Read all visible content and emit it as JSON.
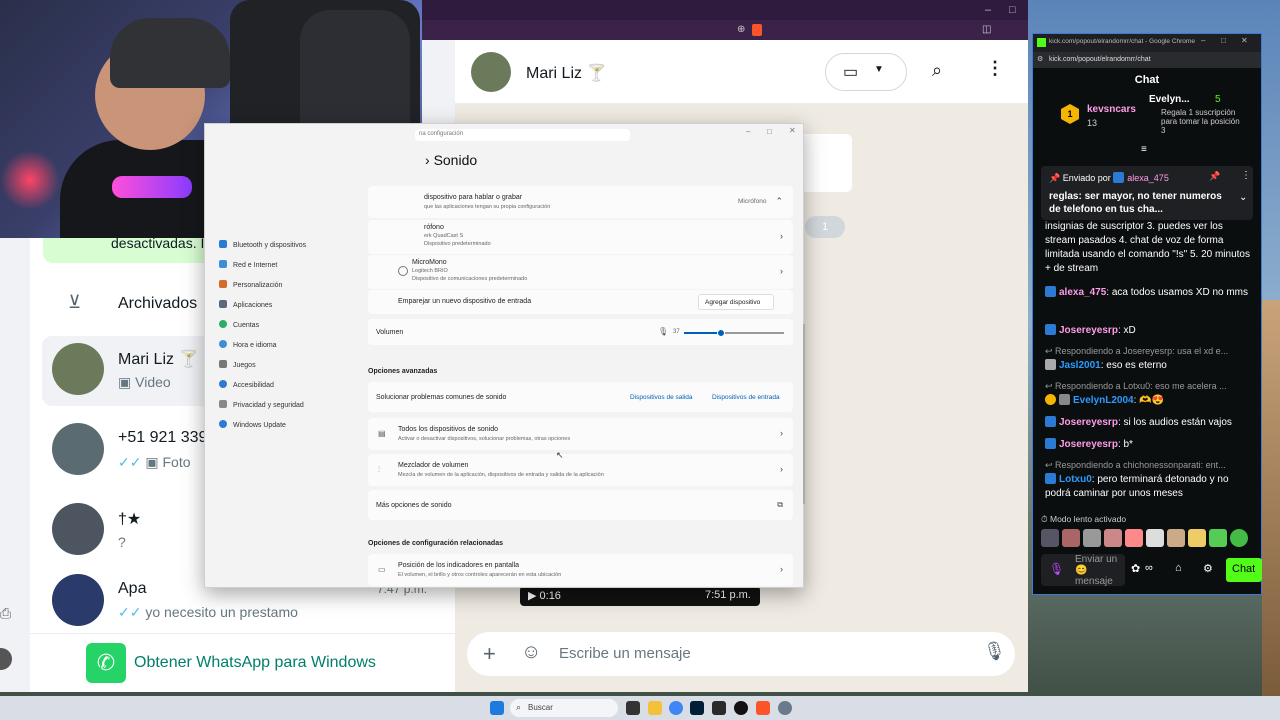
{
  "whatsapp": {
    "contact_header": {
      "name": "Mari Liz 🍸"
    },
    "chat_input_placeholder": "Escribe un mensaje",
    "bubble_count": "1",
    "video_bubble": {
      "duration": "0:16",
      "time": "7:51 p.m."
    },
    "notice_text": "desactivadas. I",
    "archived_label": "Archivados",
    "chats": [
      {
        "name": "Mari Liz 🍸",
        "preview": "Video"
      },
      {
        "name": "+51 921 339",
        "preview": "Foto"
      },
      {
        "name": "†★",
        "preview": "?"
      },
      {
        "name": "Apa",
        "preview": "yo necesito un prestamo",
        "time": "7:47 p.m."
      }
    ],
    "get_windows_label": "Obtener WhatsApp para Windows"
  },
  "settings": {
    "search_placeholder": "na configuración",
    "title": "Sonido",
    "input_header": {
      "title": "dispositivo para hablar o grabar",
      "subtitle": "que las aplicaciones tengan su propia configuración",
      "value": "Micrófono"
    },
    "devices": [
      {
        "name": "rófono",
        "model": "erk QuadCast S",
        "role": "Dispositivo predeterminado"
      },
      {
        "name": "MicroMono",
        "model": "Logitech BRIO",
        "role": "Dispositivo de comunicaciones predeterminado"
      }
    ],
    "pair_label": "Emparejar un nuevo dispositivo de entrada",
    "pair_button": "Agregar dispositivo",
    "volume_label": "Volumen",
    "volume_value": "37",
    "volume_fraction": 0.37,
    "advanced_header": "Opciones avanzadas",
    "troubleshoot_label": "Solucionar problemas comunes de sonido",
    "troubleshoot_out": "Dispositivos de salida",
    "troubleshoot_in": "Dispositivos de entrada",
    "all_devices": {
      "title": "Todos los dispositivos de sonido",
      "subtitle": "Activar o desactivar dispositivos, solucionar problemas, otras opciones"
    },
    "mixer": {
      "title": "Mezclador de volumen",
      "subtitle": "Mezcla de volumen de la aplicación, dispositivos de entrada y salida de la aplicación"
    },
    "more_options": "Más opciones de sonido",
    "related_header": "Opciones de configuración relacionadas",
    "indicators": {
      "title": "Posición de los indicadores en pantalla",
      "subtitle": "El volumen, el brillo y otros controles aparecerán en esta ubicación"
    },
    "nav": [
      "Bluetooth y dispositivos",
      "Red e Internet",
      "Personalización",
      "Aplicaciones",
      "Cuentas",
      "Hora e idioma",
      "Juegos",
      "Accesibilidad",
      "Privacidad y seguridad",
      "Windows Update"
    ]
  },
  "kick": {
    "window_title": "kick.com/popout/elrandomrr/chat - Google Chrome",
    "url": "kick.com/popout/elrandomrr/chat",
    "chat_title": "Chat",
    "leader1": {
      "name": "kevsncars",
      "count": "13"
    },
    "leader2": {
      "name": "Evelyn...",
      "count": "5",
      "text": "Regala 1 suscripción para tomar la posición 3"
    },
    "pinned": {
      "label": "Enviado por",
      "user": "alexa_475",
      "text": "reglas: ser mayor, no tener numeros de telefono en tus cha..."
    },
    "partial_text": "insignias de suscriptor 3. puedes ver los stream pasados 4. chat de voz de forma limitada usando el comando \"!s\" 5. 20 minutos + de stream",
    "messages": [
      {
        "user": "alexa_475",
        "text": ": aca todos usamos XD no mms"
      },
      {
        "user": "Josereyesrp",
        "text": ": xD"
      },
      {
        "reply": "Respondiendo a Josereyesrp: usa el xd e...",
        "user": "Jasl2001",
        "text": ": eso es eterno"
      },
      {
        "reply": "Respondiendo a Lotxu0: eso me acelera ...",
        "user": "EvelynL2004",
        "text": ": 🫶😍"
      },
      {
        "user": "Josereyesrp",
        "text": ": si los audios están vajos"
      },
      {
        "user": "Josereyesrp",
        "text": ": b*"
      },
      {
        "reply": "Respondiendo a chichonessonparati: ent...",
        "user": "Lotxu0",
        "text": ": pero terminará detonado y no podrá caminar por unos meses"
      }
    ],
    "slow_mode": "Modo lento activado",
    "send_placeholder": "Enviar un 😊 mensaje",
    "chat_button": "Chat",
    "colors": {
      "accent": "#53fc18",
      "user_pink": "#ff9de8",
      "user_blue": "#2b7bd4"
    }
  },
  "taskbar": {
    "search_label": "Buscar"
  }
}
